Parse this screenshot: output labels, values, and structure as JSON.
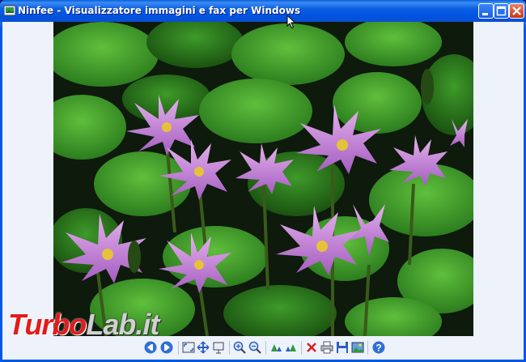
{
  "window": {
    "title": "Ninfee - Visualizzatore immagini e fax per Windows"
  },
  "title_buttons": {
    "minimize": "minimize-icon",
    "maximize": "maximize-icon",
    "close": "close-icon"
  },
  "image": {
    "subject": "Ninfee"
  },
  "toolbar": {
    "icons": [
      "previous-image-icon",
      "next-image-icon",
      "best-fit-icon",
      "actual-size-icon",
      "slideshow-icon",
      "zoom-in-icon",
      "zoom-out-icon",
      "rotate-clockwise-icon",
      "rotate-counterclockwise-icon",
      "delete-icon",
      "print-icon",
      "save-icon",
      "open-editor-icon",
      "help-icon"
    ]
  },
  "watermark": {
    "part1": "Turbo",
    "part2": "Lab.it"
  },
  "colors": {
    "titlebar": "#0054e3",
    "client_bg": "#eef2fb",
    "close_button": "#c2381b",
    "watermark_red": "#e31b1b"
  }
}
